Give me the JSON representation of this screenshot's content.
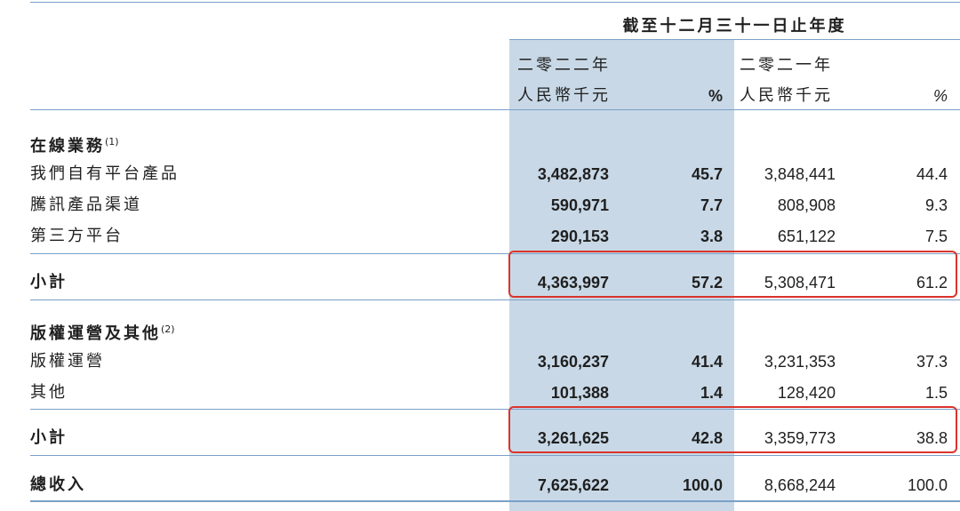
{
  "header": {
    "period": "截至十二月三十一日止年度",
    "year_2022": "二零二二年",
    "year_2021": "二零二一年",
    "currency_2022": "人民幣千元",
    "currency_2021": "人民幣千元",
    "pct_2022": "%",
    "pct_2021": "%"
  },
  "sections": {
    "online": {
      "title": "在線業務",
      "note": "(1)",
      "rows": [
        {
          "label": "我們自有平台產品",
          "v2022": "3,482,873",
          "p2022": "45.7",
          "v2021": "3,848,441",
          "p2021": "44.4"
        },
        {
          "label": "騰訊產品渠道",
          "v2022": "590,971",
          "p2022": "7.7",
          "v2021": "808,908",
          "p2021": "9.3"
        },
        {
          "label": "第三方平台",
          "v2022": "290,153",
          "p2022": "3.8",
          "v2021": "651,122",
          "p2021": "7.5"
        }
      ],
      "subtotal": {
        "label": "小計",
        "v2022": "4,363,997",
        "p2022": "57.2",
        "v2021": "5,308,471",
        "p2021": "61.2"
      }
    },
    "copyright": {
      "title": "版權運營及其他",
      "note": "(2)",
      "rows": [
        {
          "label": "版權運營",
          "v2022": "3,160,237",
          "p2022": "41.4",
          "v2021": "3,231,353",
          "p2021": "37.3"
        },
        {
          "label": "其他",
          "v2022": "101,388",
          "p2022": "1.4",
          "v2021": "128,420",
          "p2021": "1.5"
        }
      ],
      "subtotal": {
        "label": "小計",
        "v2022": "3,261,625",
        "p2022": "42.8",
        "v2021": "3,359,773",
        "p2021": "38.8"
      }
    }
  },
  "total": {
    "label": "總收入",
    "v2022": "7,625,622",
    "p2022": "100.0",
    "v2021": "8,668,244",
    "p2021": "100.0"
  },
  "colors": {
    "highlight": "#c8d8e6",
    "rule": "#7aa0c8",
    "annotation": "#d9342b"
  }
}
